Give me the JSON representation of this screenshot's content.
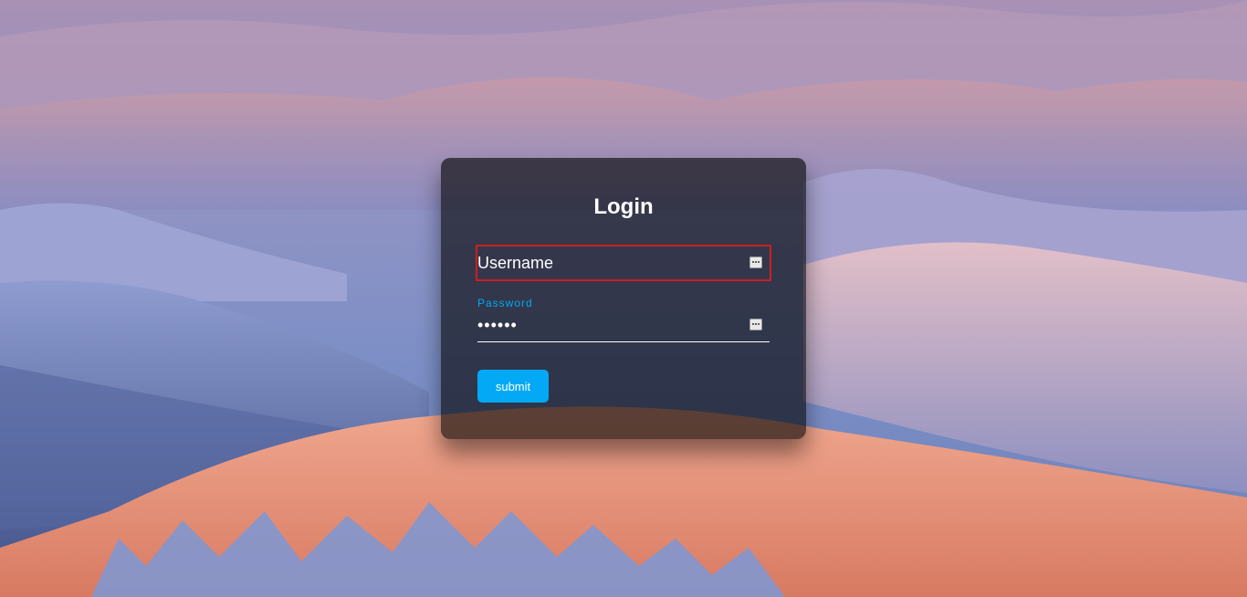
{
  "login": {
    "title": "Login",
    "username": {
      "placeholder": "Username",
      "value": ""
    },
    "password": {
      "label": "Password",
      "value": "123456"
    },
    "submit_label": "submit"
  },
  "colors": {
    "accent": "#03a9f4",
    "focus_outline": "#cc1f1f",
    "panel": "rgba(0,0,0,0.62)"
  },
  "icons": {
    "username_field_icon": "password-manager-key-icon",
    "password_field_icon": "password-manager-key-icon"
  }
}
